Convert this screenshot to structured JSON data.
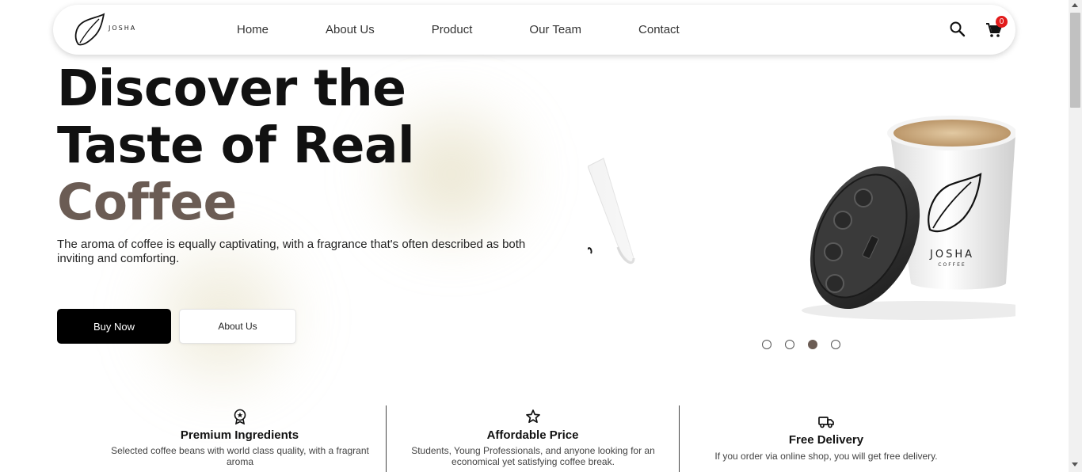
{
  "navbar": {
    "logo_text": "JOSHA",
    "links": [
      "Home",
      "About Us",
      "Product",
      "Our Team",
      "Contact"
    ],
    "cart_count": "0",
    "icons": {
      "search": "search-icon",
      "cart": "cart-icon"
    }
  },
  "hero": {
    "title_line1": "Discover the",
    "title_line2": "Taste of Real",
    "title_accent": "Coffee",
    "description": "The aroma of coffee is equally captivating, with a fragrance that's often described as both inviting and comforting.",
    "buy_label": "Buy Now",
    "about_label": "About Us"
  },
  "carousel": {
    "cup_brand": "JOSHA",
    "cup_sub": "COFFEE",
    "slide_count": 4,
    "active_index": 2
  },
  "features": [
    {
      "icon": "award-icon",
      "title": "Premium Ingredients",
      "desc": "Selected coffee beans with world class quality, with a fragrant aroma"
    },
    {
      "icon": "star-icon",
      "title": "Affordable Price",
      "desc": "Students, Young Professionals, and anyone looking for an economical yet satisfying coffee break."
    },
    {
      "icon": "truck-icon",
      "title": "Free Delivery",
      "desc": "If you order via online shop, you will get free delivery."
    }
  ],
  "colors": {
    "accent": "#6b5c54",
    "badge": "#e21b1b",
    "button_dark": "#000000"
  }
}
